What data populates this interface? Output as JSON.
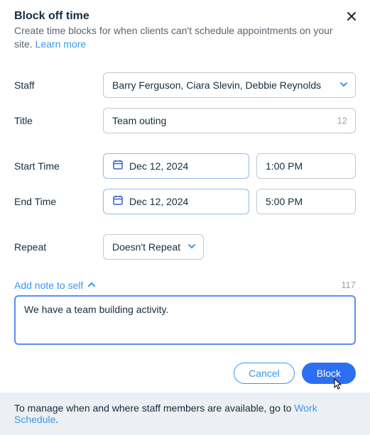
{
  "header": {
    "title": "Block off time",
    "subtitle_prefix": "Create time blocks for when clients can't schedule appointments on your site. ",
    "learn_more": "Learn more"
  },
  "labels": {
    "staff": "Staff",
    "title": "Title",
    "start_time": "Start Time",
    "end_time": "End Time",
    "repeat": "Repeat"
  },
  "fields": {
    "staff": "Barry Ferguson, Ciara Slevin, Debbie Reynolds",
    "title": "Team outing",
    "title_count": "12",
    "start_date": "Dec 12, 2024",
    "start_time": "1:00 PM",
    "end_date": "Dec 12, 2024",
    "end_time": "5:00 PM",
    "repeat": "Doesn't Repeat"
  },
  "note": {
    "toggle_label": "Add note to self",
    "char_count": "117",
    "content": "We have a team building activity."
  },
  "actions": {
    "cancel": "Cancel",
    "block": "Block"
  },
  "footer": {
    "prefix": "To manage when and where staff members are available, go to ",
    "link": "Work Schedule",
    "suffix": "."
  }
}
